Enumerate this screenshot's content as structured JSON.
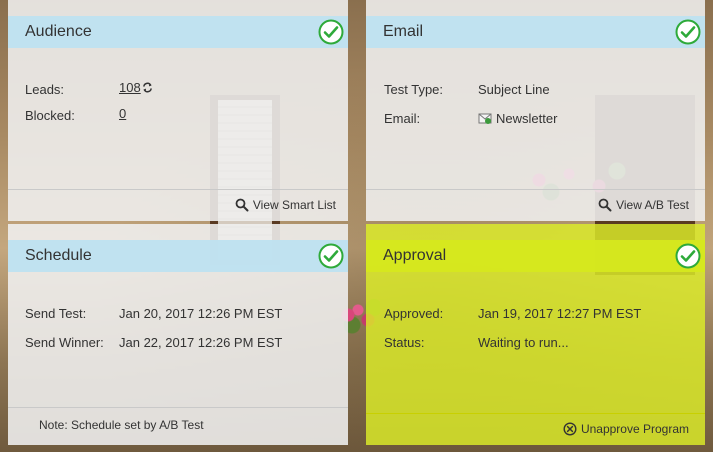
{
  "audience": {
    "title": "Audience",
    "leads_label": "Leads:",
    "leads_value": "108",
    "blocked_label": "Blocked:",
    "blocked_value": "0",
    "action_label": "View Smart List"
  },
  "email": {
    "title": "Email",
    "test_type_label": "Test Type:",
    "test_type_value": "Subject Line",
    "email_label": "Email:",
    "email_value": "Newsletter",
    "action_label": "View A/B Test"
  },
  "schedule": {
    "title": "Schedule",
    "send_test_label": "Send Test:",
    "send_test_value": "Jan 20, 2017 12:26 PM EST",
    "send_winner_label": "Send Winner:",
    "send_winner_value": "Jan 22, 2017 12:26 PM EST",
    "note": "Note: Schedule set by A/B Test"
  },
  "approval": {
    "title": "Approval",
    "approved_label": "Approved:",
    "approved_value": "Jan 19, 2017 12:27 PM EST",
    "status_label": "Status:",
    "status_value": "Waiting to run...",
    "action_label": "Unapprove Program"
  },
  "colors": {
    "header_blue": "#bee2f0",
    "approval_yellow": "#dde828",
    "check_green": "#2eaa3a"
  },
  "icons": {
    "check": "check-circle-icon",
    "refresh": "refresh-icon",
    "email": "email-icon",
    "search": "search-icon",
    "unapprove": "circle-x-icon"
  }
}
